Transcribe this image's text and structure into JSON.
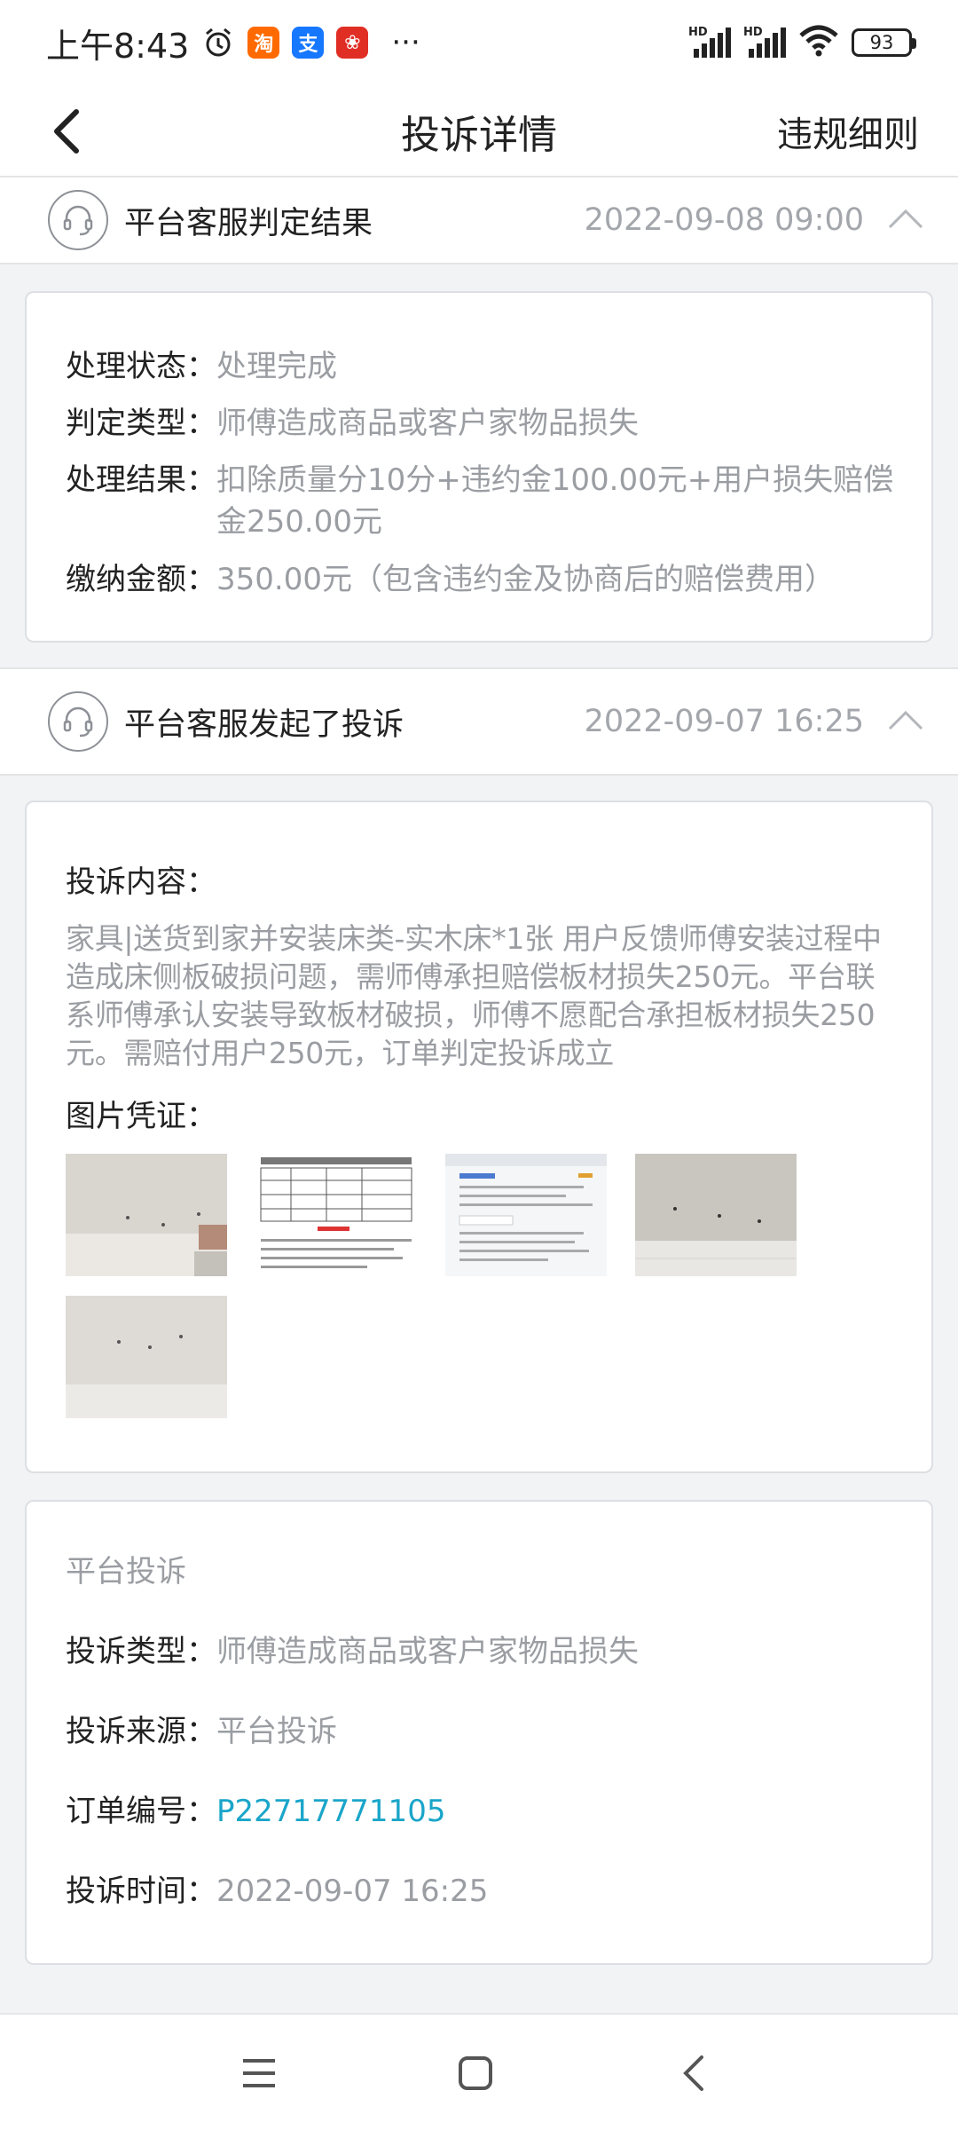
{
  "status_bar": {
    "time": "上午8:43",
    "app_icons": [
      {
        "name": "taobao-icon",
        "glyph": "淘",
        "color": "#ff6a00"
      },
      {
        "name": "alipay-icon",
        "glyph": "支",
        "color": "#1677ff"
      },
      {
        "name": "pinduoduo-icon",
        "glyph": "❀",
        "color": "#e02e24"
      }
    ],
    "more": "···",
    "signal_hd": "HD",
    "battery": "93"
  },
  "nav": {
    "title": "投诉详情",
    "rules_link": "违规细则"
  },
  "events": [
    {
      "title": "平台客服判定结果",
      "time": "2022-09-08 09:00",
      "details": [
        {
          "key": "处理状态：",
          "value": "处理完成"
        },
        {
          "key": "判定类型：",
          "value": "师傅造成商品或客户家物品损失"
        },
        {
          "key": "处理结果：",
          "value": "扣除质量分10分+违约金100.00元+用户损失赔偿金250.00元"
        },
        {
          "key": "缴纳金额：",
          "value": "350.00元（包含违约金及协商后的赔偿费用）"
        }
      ]
    },
    {
      "title": "平台客服发起了投诉",
      "time": "2022-09-07 16:25",
      "content_label": "投诉内容：",
      "content_text": "家具|送货到家并安装床类-实木床*1张 用户反馈师傅安装过程中造成床侧板破损问题，需师傅承担赔偿板材损失250元。平台联系师傅承认安装导致板材破损，师傅不愿配合承担板材损失250元。需赔付用户250元，订单判定投诉成立",
      "photos_label": "图片凭证：",
      "photos": [
        "wall-photo",
        "document-screenshot",
        "chat-screenshot",
        "wall-photo",
        "wall-photo"
      ]
    }
  ],
  "complaint_info": {
    "section_title": "平台投诉",
    "rows": [
      {
        "key": "投诉类型：",
        "value": "师傅造成商品或客户家物品损失"
      },
      {
        "key": "投诉来源：",
        "value": "平台投诉"
      },
      {
        "key": "订单编号：",
        "value": "P22717771105",
        "link": true
      },
      {
        "key": "投诉时间：",
        "value": "2022-09-07 16:25"
      }
    ]
  },
  "colors": {
    "link": "#1aa5c9",
    "muted_text": "#9a9da2",
    "background": "#f2f3f5"
  }
}
